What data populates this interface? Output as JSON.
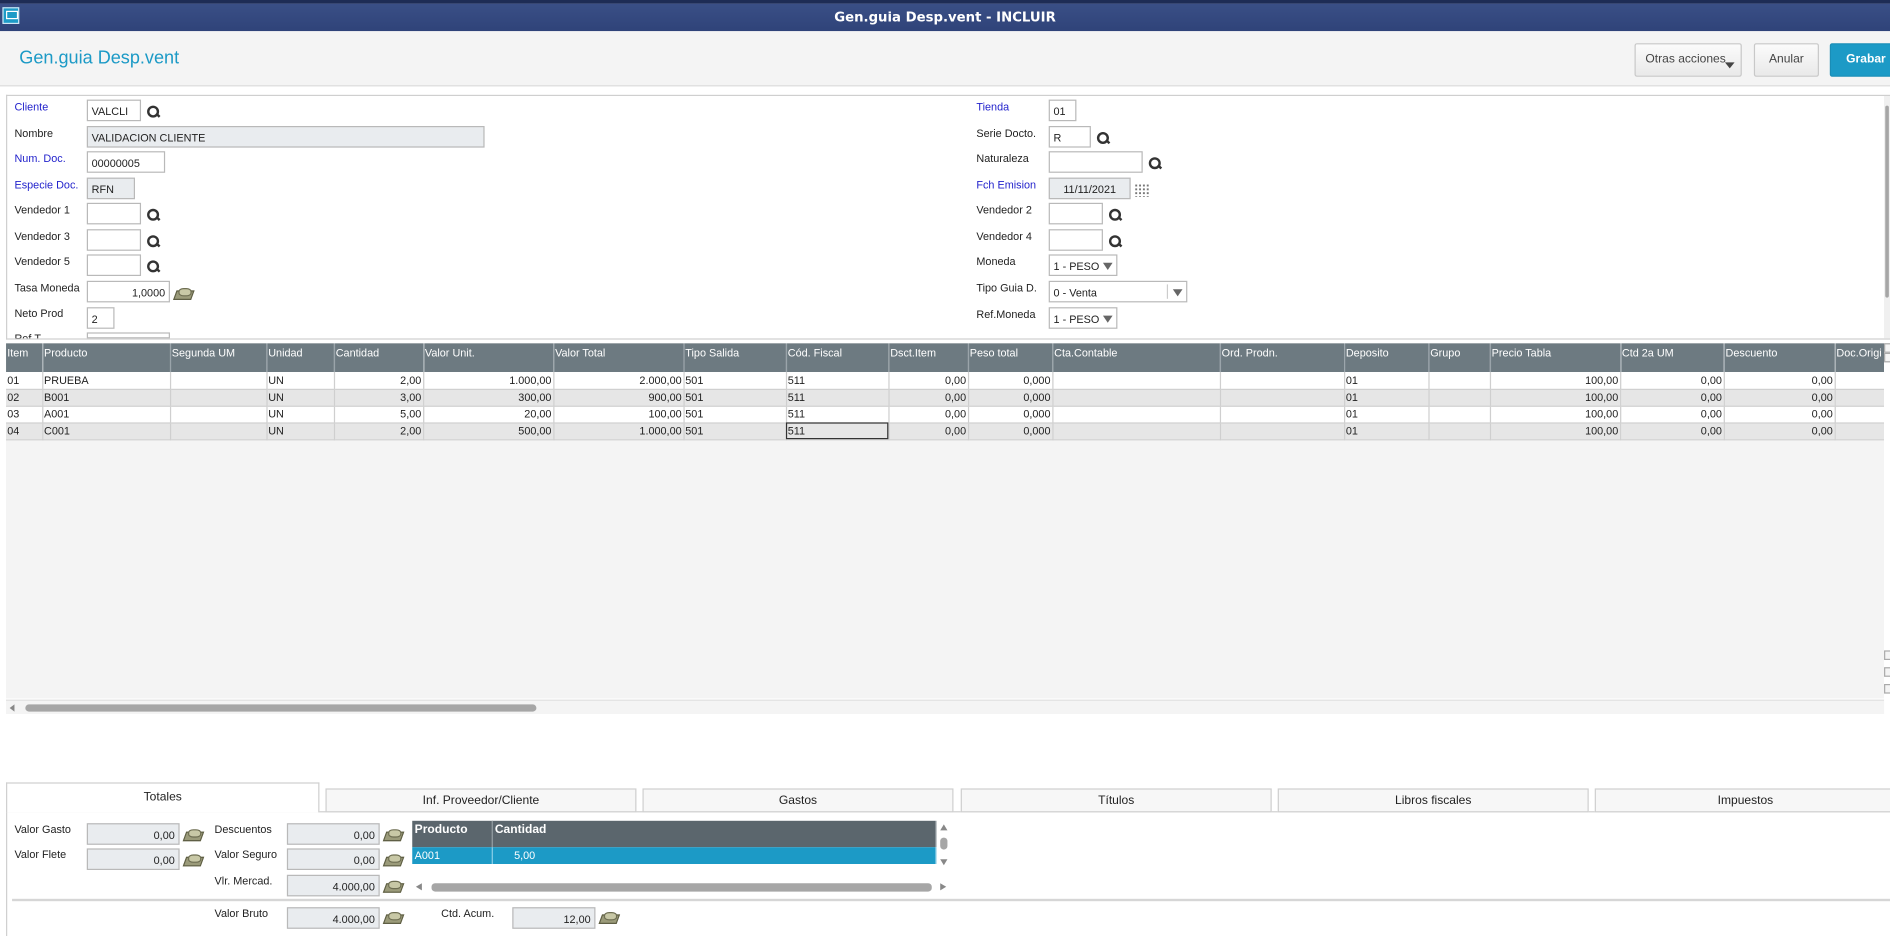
{
  "window": {
    "title": "Gen.guia Desp.vent - INCLUIR"
  },
  "header": {
    "title": "Gen.guia Desp.vent",
    "buttons": {
      "otras": "Otras acciones",
      "anular": "Anular",
      "grabar": "Grabar"
    }
  },
  "form": {
    "left": {
      "cliente": {
        "label": "Cliente",
        "value": "VALCLI"
      },
      "nombre": {
        "label": "Nombre",
        "value": "VALIDACION CLIENTE"
      },
      "num_doc": {
        "label": "Num. Doc.",
        "value": "00000005"
      },
      "especie_doc": {
        "label": "Especie Doc.",
        "value": "RFN"
      },
      "vendedor1": {
        "label": "Vendedor 1",
        "value": ""
      },
      "vendedor3": {
        "label": "Vendedor 3",
        "value": ""
      },
      "vendedor5": {
        "label": "Vendedor 5",
        "value": ""
      },
      "tasa_moneda": {
        "label": "Tasa Moneda",
        "value": "1,0000"
      },
      "neto_prod": {
        "label": "Neto Prod",
        "value": "2"
      },
      "ref_t": {
        "label": "Ref.T",
        "value": ""
      }
    },
    "right": {
      "tienda": {
        "label": "Tienda",
        "value": "01"
      },
      "serie_docto": {
        "label": "Serie Docto.",
        "value": "R"
      },
      "naturaleza": {
        "label": "Naturaleza",
        "value": ""
      },
      "fch_emision": {
        "label": "Fch Emision",
        "value": "11/11/2021"
      },
      "vendedor2": {
        "label": "Vendedor 2",
        "value": ""
      },
      "vendedor4": {
        "label": "Vendedor 4",
        "value": ""
      },
      "moneda": {
        "label": "Moneda",
        "value": "1 - PESO"
      },
      "tipo_guia": {
        "label": "Tipo Guia D.",
        "value": "0 - Venta"
      },
      "ref_moneda": {
        "label": "Ref.Moneda",
        "value": "1 - PESO"
      }
    }
  },
  "grid": {
    "columns": [
      "Item",
      "Producto",
      "Segunda UM",
      "Unidad",
      "Cantidad",
      "Valor Unit.",
      "Valor Total",
      "Tipo Salida",
      "Cód. Fiscal",
      "Dsct.Item",
      "Peso total",
      "Cta.Contable",
      "Ord. Prodn.",
      "Deposito",
      "Grupo",
      "Precio Tabla",
      "Ctd 2a UM",
      "Descuento",
      "Doc.Origi"
    ],
    "rows": [
      [
        "01",
        "PRUEBA",
        "",
        "UN",
        "2,00",
        "1.000,00",
        "2.000,00",
        "501",
        "511",
        "0,00",
        "0,000",
        "",
        "",
        "01",
        "",
        "100,00",
        "0,00",
        "0,00",
        ""
      ],
      [
        "02",
        "B001",
        "",
        "UN",
        "3,00",
        "300,00",
        "900,00",
        "501",
        "511",
        "0,00",
        "0,000",
        "",
        "",
        "01",
        "",
        "100,00",
        "0,00",
        "0,00",
        ""
      ],
      [
        "03",
        "A001",
        "",
        "UN",
        "5,00",
        "20,00",
        "100,00",
        "501",
        "511",
        "0,00",
        "0,000",
        "",
        "",
        "01",
        "",
        "100,00",
        "0,00",
        "0,00",
        ""
      ],
      [
        "04",
        "C001",
        "",
        "UN",
        "2,00",
        "500,00",
        "1.000,00",
        "501",
        "511",
        "0,00",
        "0,000",
        "",
        "",
        "01",
        "",
        "100,00",
        "0,00",
        "0,00",
        ""
      ]
    ]
  },
  "tabs": [
    "Totales",
    "Inf. Proveedor/Cliente",
    "Gastos",
    "Títulos",
    "Libros fiscales",
    "Impuestos"
  ],
  "totales": {
    "valor_gasto": {
      "label": "Valor Gasto",
      "value": "0,00"
    },
    "valor_flete": {
      "label": "Valor Flete",
      "value": "0,00"
    },
    "descuentos": {
      "label": "Descuentos",
      "value": "0,00"
    },
    "valor_seguro": {
      "label": "Valor Seguro",
      "value": "0,00"
    },
    "vlr_mercad": {
      "label": "Vlr. Mercad.",
      "value": "4.000,00"
    },
    "valor_bruto": {
      "label": "Valor Bruto",
      "value": "4.000,00"
    },
    "ctd_acum": {
      "label": "Ctd. Acum.",
      "value": "12,00"
    },
    "mini_grid": {
      "columns": [
        "Producto",
        "Cantidad"
      ],
      "rows": [
        [
          "A001",
          "5,00"
        ]
      ]
    }
  }
}
